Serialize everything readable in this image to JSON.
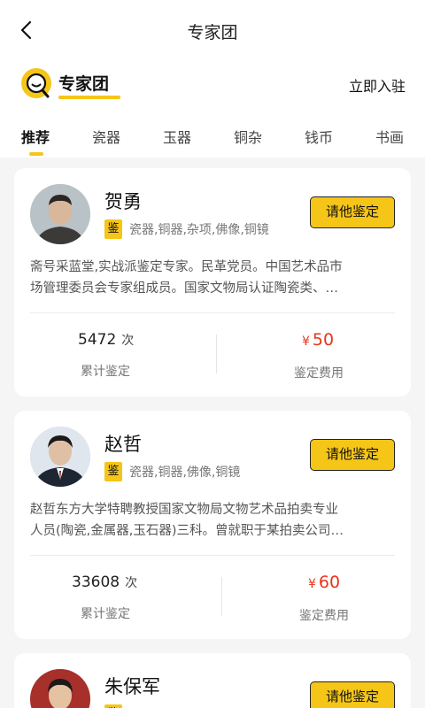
{
  "header": {
    "title": "专家团"
  },
  "brand": {
    "title": "专家团",
    "join_label": "立即入驻",
    "accent_color": "#f5c518"
  },
  "tabs": [
    {
      "label": "推荐",
      "active": true
    },
    {
      "label": "瓷器"
    },
    {
      "label": "玉器"
    },
    {
      "label": "铜杂"
    },
    {
      "label": "钱币"
    },
    {
      "label": "书画"
    }
  ],
  "experts": [
    {
      "name": "贺勇",
      "badge": "鉴",
      "tags": "瓷器,铜器,杂项,佛像,铜镜",
      "button": "请他鉴定",
      "desc_line1": "斋号采蓝堂,实战派鉴定专家。民革党员。中国艺术品市",
      "desc_line2": "场管理委员会专家组成员。国家文物局认证陶瓷类、…",
      "count": "5472",
      "count_unit": "次",
      "count_label": "累计鉴定",
      "fee_symbol": "¥",
      "fee": "50",
      "fee_label": "鉴定费用"
    },
    {
      "name": "赵哲",
      "badge": "鉴",
      "tags": "瓷器,铜器,佛像,铜镜",
      "button": "请他鉴定",
      "desc_line1": "赵哲东方大学特聘教授国家文物局文物艺术品拍卖专业",
      "desc_line2": "人员(陶瓷,金属器,玉石器)三科。曾就职于某拍卖公司…",
      "count": "33608",
      "count_unit": "次",
      "count_label": "累计鉴定",
      "fee_symbol": "¥",
      "fee": "60",
      "fee_label": "鉴定费用"
    },
    {
      "name": "朱保军",
      "badge": "鉴",
      "button": "请他鉴定"
    }
  ]
}
